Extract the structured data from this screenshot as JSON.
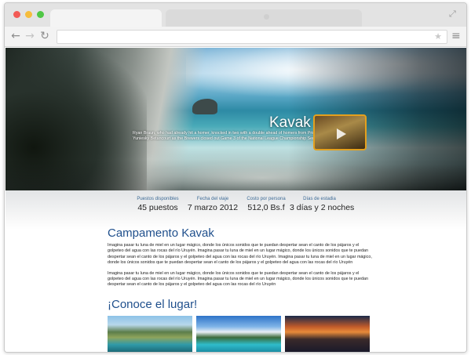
{
  "hero": {
    "title": "Kavak",
    "description": "Ryan Braun, who had already hit a homer, knocked in two with a double ahead of homers from Prince Fielder and Yuniesky Betancourt as the Brewers closed out Game 3 of the National League Championship Series."
  },
  "stats": [
    {
      "label": "Puestos disponibles",
      "value": "45 puestos"
    },
    {
      "label": "Fecha del viaje",
      "value": "7 marzo 2012"
    },
    {
      "label": "Costo por persona",
      "value": "512,0 Bs.f"
    },
    {
      "label": "Días de estadia",
      "value": "3 días y 2 noches"
    }
  ],
  "content": {
    "title": "Campamento Kavak",
    "paragraph1": "Imagina pasar tu luna de miel en un lugar mágico, donde los únicos sonidos que te puedan despertar sean el canto de los pájaros y el golpeteo del agua con las rocas del río Uruyén. Imagina pasar tu luna de miel en un lugar mágico, donde los únicos sonidos que te puedan despertar sean el canto de los pájaros y el golpeteo del agua con las rocas del río Uruyén. Imagina pasar tu luna de miel en un lugar mágico, donde los únicos sonidos que te puedan despertar sean el canto de los pájaros y el golpeteo del agua con las rocas del río Uruyén",
    "paragraph2": "Imagina pasar tu luna de miel en un lugar mágico, donde los únicos sonidos que te puedan despertar sean el canto de los pájaros y el golpeteo del agua con las rocas del río Uruyén. Imagina pasar tu luna de miel en un lugar mágico, donde los únicos sonidos que te puedan despertar sean el canto de los pájaros y el golpeteo del agua con las rocas del río Uruyén",
    "gallery_title": "¡Conoce el lugar!"
  },
  "browser": {
    "back_icon": "←",
    "forward_icon": "→",
    "reload_icon": "↻",
    "star_icon": "★",
    "menu_icon": "≡",
    "expand_icon": "⤢"
  },
  "colors": {
    "accent": "#1f4f8c",
    "stat_label": "#3d6a96",
    "video_border": "#e3a01e"
  }
}
